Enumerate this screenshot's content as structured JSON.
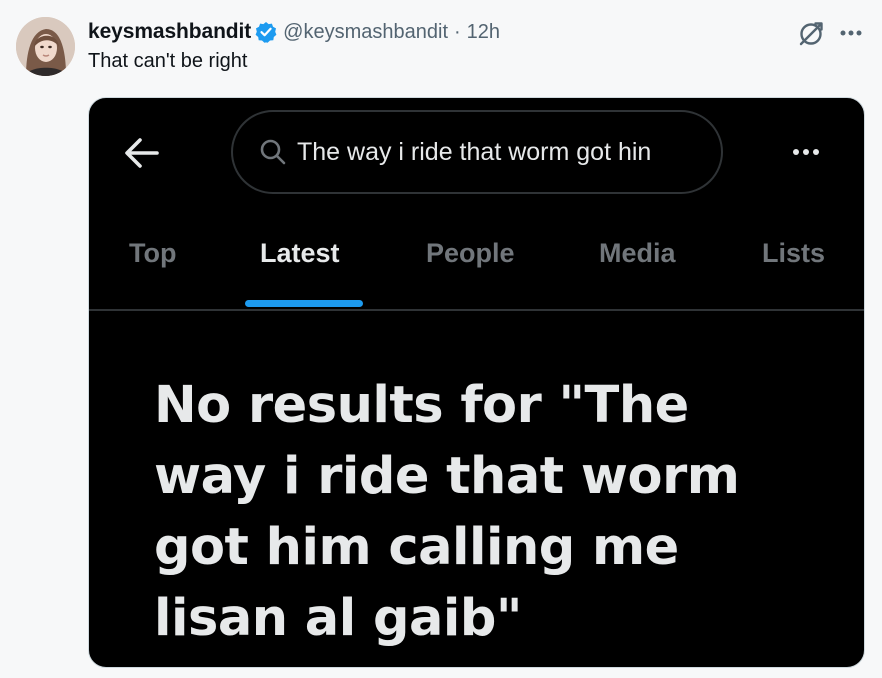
{
  "tweet": {
    "display_name": "keysmashbandit",
    "handle": "@keysmashbandit",
    "separator": "·",
    "time": "12h",
    "text": "That can't be right",
    "avatar_icon": "profile-avatar",
    "verified_icon": "verified-badge-icon",
    "verified_color": "#1d9bf0"
  },
  "screenshot": {
    "search_query": "The way i ride that worm got hin",
    "tabs": [
      {
        "label": "Top",
        "active": false
      },
      {
        "label": "Latest",
        "active": true
      },
      {
        "label": "People",
        "active": false
      },
      {
        "label": "Media",
        "active": false
      },
      {
        "label": "Lists",
        "active": false
      }
    ],
    "no_results_text": "No results for \"The way i ride that worm got him calling me lisan al gaib\"",
    "accent_color": "#1d9bf0",
    "background_color": "#000000"
  }
}
